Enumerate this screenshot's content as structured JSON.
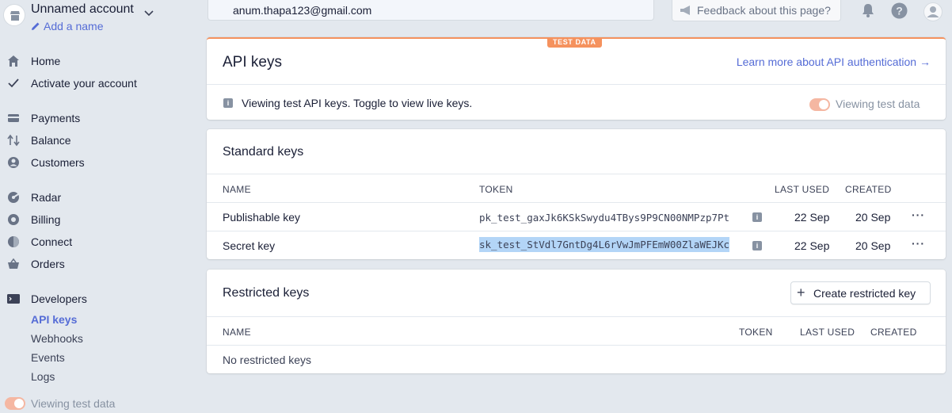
{
  "account": {
    "name": "Unnamed account",
    "add_name": "Add a name"
  },
  "sidebar": {
    "items": [
      {
        "label": "Home"
      },
      {
        "label": "Activate your account"
      },
      {
        "label": "Payments"
      },
      {
        "label": "Balance"
      },
      {
        "label": "Customers"
      },
      {
        "label": "Radar"
      },
      {
        "label": "Billing"
      },
      {
        "label": "Connect"
      },
      {
        "label": "Orders"
      },
      {
        "label": "Developers"
      }
    ],
    "developer_sub": [
      {
        "label": "API keys",
        "active": true
      },
      {
        "label": "Webhooks"
      },
      {
        "label": "Events"
      },
      {
        "label": "Logs"
      }
    ],
    "toggle_label": "Viewing test data"
  },
  "topbar": {
    "search_value": "anum.thapa123@gmail.com",
    "feedback_label": "Feedback about this page?"
  },
  "api_keys": {
    "badge": "TEST DATA",
    "title": "API keys",
    "learn_link": "Learn more about API authentication →",
    "info": "Viewing test API keys. Toggle to view live keys.",
    "toggle_label": "Viewing test data"
  },
  "standard_keys": {
    "title": "Standard keys",
    "headers": {
      "name": "NAME",
      "token": "TOKEN",
      "last_used": "LAST USED",
      "created": "CREATED"
    },
    "rows": [
      {
        "name": "Publishable key",
        "token": "pk_test_gaxJk6KSkSwydu4TBys9P9CN00NMPzp7Pt",
        "last_used": "22 Sep",
        "created": "20 Sep"
      },
      {
        "name": "Secret key",
        "token": "sk_test_StVdl7GntDg4L6rVwJmPFEmW00ZlaWEJKc",
        "last_used": "22 Sep",
        "created": "20 Sep"
      }
    ]
  },
  "restricted_keys": {
    "title": "Restricted keys",
    "create_button": "Create restricted key",
    "headers": {
      "name": "NAME",
      "token": "TOKEN",
      "last_used": "LAST USED",
      "created": "CREATED"
    },
    "empty": "No restricted keys"
  },
  "colors": {
    "accent": "#556cd6",
    "test_orange": "#f5925e",
    "background": "#e3e8ee"
  }
}
